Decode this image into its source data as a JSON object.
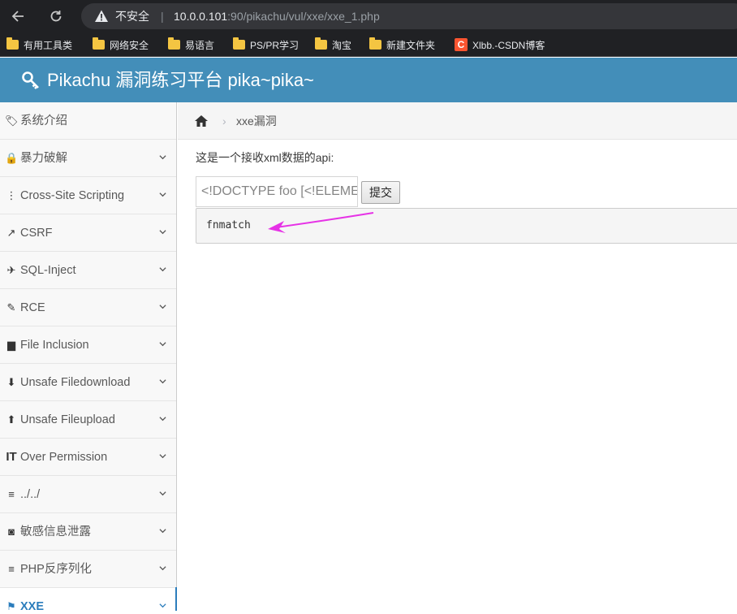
{
  "browser": {
    "security_label": "不安全",
    "separator": "|",
    "url_host": "10.0.0.101",
    "url_path": ":90/pikachu/vul/xxe/xxe_1.php"
  },
  "bookmarks": [
    {
      "label": "有用工具类",
      "icon": "folder-icon"
    },
    {
      "label": "网络安全",
      "icon": "folder-icon"
    },
    {
      "label": "易语言",
      "icon": "folder-icon"
    },
    {
      "label": "PS/PR学习",
      "icon": "folder-icon"
    },
    {
      "label": "淘宝",
      "icon": "folder-icon"
    },
    {
      "label": "新建文件夹",
      "icon": "folder-icon"
    },
    {
      "label": "Xlbb.-CSDN博客",
      "icon": "csdn-icon",
      "logo_letter": "C"
    }
  ],
  "header": {
    "title": "Pikachu 漏洞练习平台 pika~pika~",
    "icon": "key-icon"
  },
  "sidebar": {
    "items": [
      {
        "label": "系统介绍",
        "icon": "tags-icon",
        "glyph": "🏷"
      },
      {
        "label": "暴力破解",
        "icon": "lock-icon",
        "glyph": "🔒"
      },
      {
        "label": "Cross-Site Scripting",
        "icon": "indent-icon",
        "glyph": "⋮"
      },
      {
        "label": "CSRF",
        "icon": "share-icon",
        "glyph": "↗"
      },
      {
        "label": "SQL-Inject",
        "icon": "plane-icon",
        "glyph": "✈"
      },
      {
        "label": "RCE",
        "icon": "pencil-icon",
        "glyph": "✎"
      },
      {
        "label": "File Inclusion",
        "icon": "file-icon",
        "glyph": "▆"
      },
      {
        "label": "Unsafe Filedownload",
        "icon": "download-icon",
        "glyph": "⬇"
      },
      {
        "label": "Unsafe Fileupload",
        "icon": "upload-icon",
        "glyph": "⬆"
      },
      {
        "label": "Over Permission",
        "icon": "text-height-icon",
        "glyph": "IT"
      },
      {
        "label": "../../",
        "icon": "align-left-icon",
        "glyph": "≡"
      },
      {
        "label": "敏感信息泄露",
        "icon": "camera-icon",
        "glyph": "◙"
      },
      {
        "label": "PHP反序列化",
        "icon": "align-left-icon",
        "glyph": "≡"
      },
      {
        "label": "XXE",
        "icon": "flag-icon",
        "glyph": "⚑",
        "active": true
      }
    ]
  },
  "breadcrumb": {
    "separator": "›",
    "current": "xxe漏洞"
  },
  "main": {
    "intro": "这是一个接收xml数据的api:",
    "input_value": "<!DOCTYPE foo [<!ELEMENT",
    "submit_label": "提交",
    "result": "fnmatch"
  },
  "colors": {
    "header_bg": "#438eb9",
    "active_blue": "#2b7dbc",
    "annotation_arrow": "#e632e6"
  }
}
